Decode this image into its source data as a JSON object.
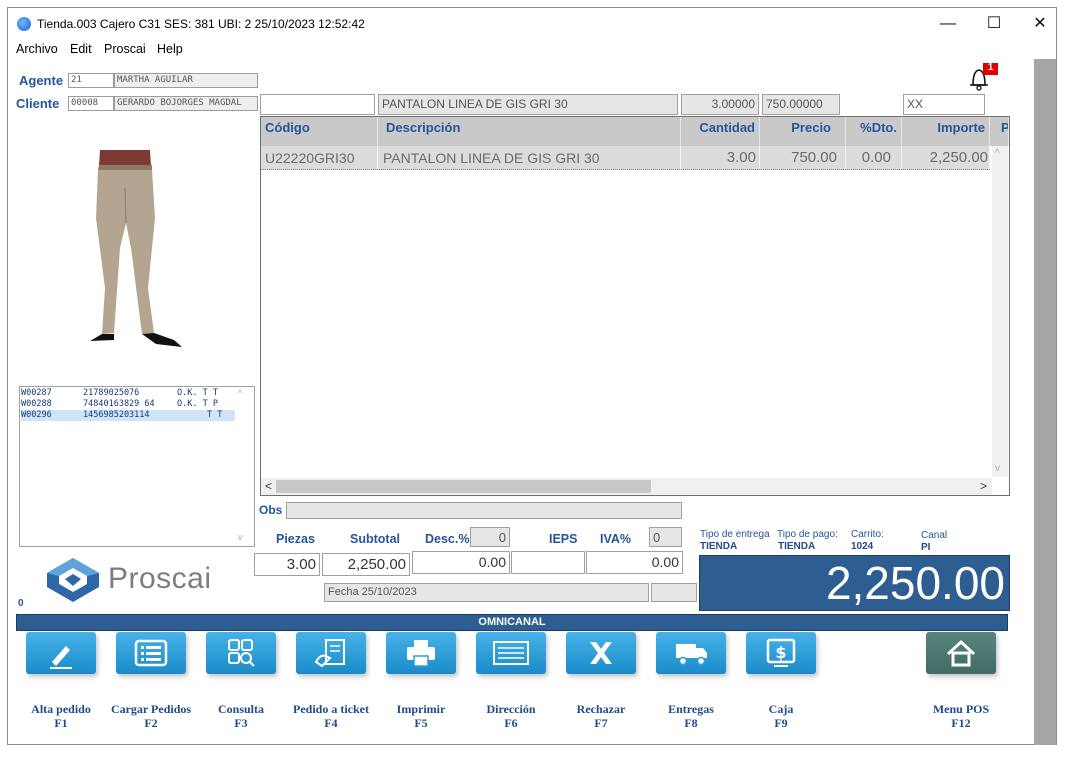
{
  "window": {
    "title": "Tienda.003  Cajero C31    SES: 381  UBI: 2  25/10/2023 12:52:42",
    "minimize": "—",
    "maximize": "☐",
    "close": "✕"
  },
  "menu": [
    "Archivo",
    "Edit",
    "Proscai",
    "Help"
  ],
  "agent": {
    "label": "Agente",
    "code": "21",
    "name": "MARTHA AGUILAR"
  },
  "client": {
    "label": "Cliente",
    "code": "00008",
    "name": "GERARDO BOJORGES MAGDAL"
  },
  "notification_count": "1",
  "item_entry": {
    "code": "",
    "description": "PANTALON LINEA DE GIS GRI 30",
    "quantity": "3.00000",
    "price": "750.00000",
    "extra": "XX"
  },
  "grid": {
    "headers": [
      "Código",
      "Descripción",
      "Cantidad",
      "Precio",
      "%Dto.",
      "Importe",
      "P"
    ],
    "rows": [
      [
        "U22220GRI30",
        "PANTALON LINEA DE GIS GRI 30",
        "3.00",
        "750.00",
        "0.00",
        "2,250.00"
      ]
    ]
  },
  "serial_list": [
    [
      "W00287",
      "21789025076",
      "O.K. T T"
    ],
    [
      "W00288",
      "74840163829 64",
      "O.K. T P"
    ],
    [
      "W00296",
      "1456985203114",
      "T T"
    ]
  ],
  "obs_label": "Obs",
  "totals": {
    "pieces_label": "Piezas",
    "subtotal_label": "Subtotal",
    "desc_label": "Desc.%",
    "desc_value": "0",
    "ieps_label": "IEPS",
    "iva_label": "IVA%",
    "iva_value": "0",
    "pieces": "3.00",
    "subtotal": "2,250.00",
    "desc_amount": "0.00",
    "ieps_amount": "",
    "iva_amount": "0.00",
    "date": "Fecha 25/10/2023",
    "grand_total": "2,250.00"
  },
  "delivery": {
    "tipo_entrega_label": "Tipo de entrega",
    "tipo_entrega": "TIENDA",
    "tipo_pago_label": "Tipo de pago:",
    "tipo_pago": "TIENDA",
    "carrito_label": "Carrito:",
    "carrito": "1024",
    "canal_label": "Canal",
    "canal": "PI"
  },
  "brand": "Proscai",
  "zero_label": "0",
  "banner": "OMNICANAL",
  "buttons": [
    {
      "label": "Alta pedido",
      "key": "F1",
      "icon": "pencil-icon"
    },
    {
      "label": "Cargar Pedidos",
      "key": "F2",
      "icon": "list-icon"
    },
    {
      "label": "Consulta",
      "key": "F3",
      "icon": "search-grid-icon"
    },
    {
      "label": "Pedido a ticket",
      "key": "F4",
      "icon": "ticket-icon"
    },
    {
      "label": "Imprimir",
      "key": "F5",
      "icon": "printer-icon"
    },
    {
      "label": "Dirección",
      "key": "F6",
      "icon": "address-icon"
    },
    {
      "label": "Rechazar",
      "key": "F7",
      "icon": "reject-icon"
    },
    {
      "label": "Entregas",
      "key": "F8",
      "icon": "truck-icon"
    },
    {
      "label": "Caja",
      "key": "F9",
      "icon": "cashbox-icon"
    },
    {
      "label": "Menu POS",
      "key": "F12",
      "icon": "home-icon"
    }
  ],
  "colors": {
    "accent": "#2c5a8c",
    "button": "#2a9fdb",
    "label": "#25559a"
  }
}
